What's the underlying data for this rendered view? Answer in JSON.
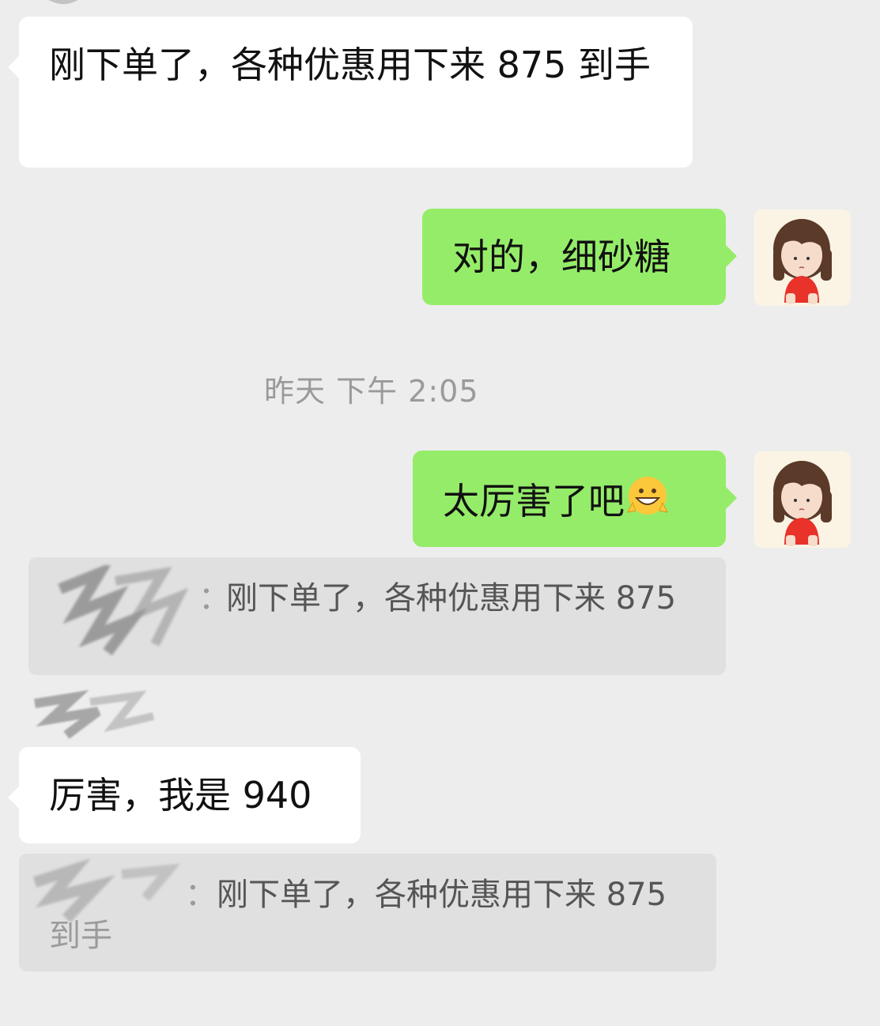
{
  "messages": {
    "m1": {
      "sender": "other",
      "text": "刚下单了，各种优惠用下来 875 到手"
    },
    "m2": {
      "sender": "me",
      "text": "对的，细砂糖"
    },
    "timestamp": "昨天 下午 2:05",
    "m3": {
      "sender": "me",
      "text": "太厉害了吧",
      "emoji": "😀"
    },
    "m3_quote": {
      "separator": "：",
      "text": "刚下单了，各种优惠用下来 875"
    },
    "m4": {
      "sender": "other",
      "text": "厉害，我是 940"
    },
    "m4_quote": {
      "separator": "：",
      "text": "刚下单了，各种优惠用下来 875",
      "continuation": "到手"
    }
  },
  "colors": {
    "background": "#ededed",
    "bubble_in": "#ffffff",
    "bubble_out": "#95ec69",
    "quote_bg": "#e0e0e0",
    "timestamp": "#9a9a9a"
  },
  "icons": {
    "avatar": "cartoon-girl-avatar-icon",
    "emoji": "grinning-peace-emoji-icon"
  }
}
